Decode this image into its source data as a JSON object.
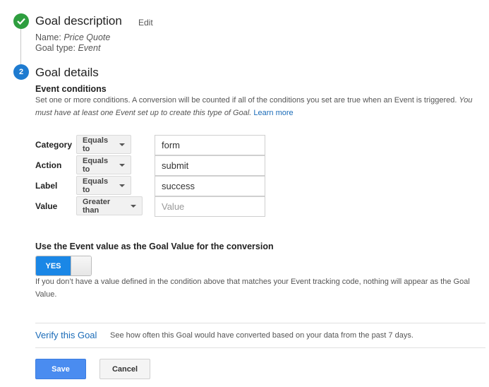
{
  "steps": [
    {
      "number": "1",
      "status": "complete",
      "title": "Goal description",
      "edit_label": "Edit",
      "meta": {
        "name_label": "Name:",
        "name_value": "Price Quote",
        "type_label": "Goal type:",
        "type_value": "Event"
      }
    },
    {
      "number": "2",
      "status": "active",
      "title": "Goal details"
    }
  ],
  "event_conditions": {
    "title": "Event conditions",
    "description": "Set one or more conditions. A conversion will be counted if all of the conditions you set are true when an Event is triggered.",
    "description_italic": "You must have at least one Event set up to create this type of Goal.",
    "learn_more": "Learn more",
    "rows": [
      {
        "label": "Category",
        "operator": "Equals to",
        "value": "form",
        "placeholder": ""
      },
      {
        "label": "Action",
        "operator": "Equals to",
        "value": "submit",
        "placeholder": ""
      },
      {
        "label": "Label",
        "operator": "Equals to",
        "value": "success",
        "placeholder": ""
      },
      {
        "label": "Value",
        "operator": "Greater than",
        "value": "",
        "placeholder": "Value"
      }
    ]
  },
  "goal_value": {
    "title": "Use the Event value as the Goal Value for the conversion",
    "toggle_label": "YES",
    "toggle_state": true,
    "help": "If you don’t have a value defined in the condition above that matches your Event tracking code, nothing will appear as the Goal Value."
  },
  "verify": {
    "link": "Verify this Goal",
    "description": "See how often this Goal would have converted based on your data from the past 7 days."
  },
  "actions": {
    "save": "Save",
    "cancel": "Cancel"
  },
  "colors": {
    "complete": "#2e9e3f",
    "active": "#1e7bd0",
    "link": "#1a6bb8",
    "primary": "#4a8cf0",
    "toggle_on": "#1a87e6"
  }
}
